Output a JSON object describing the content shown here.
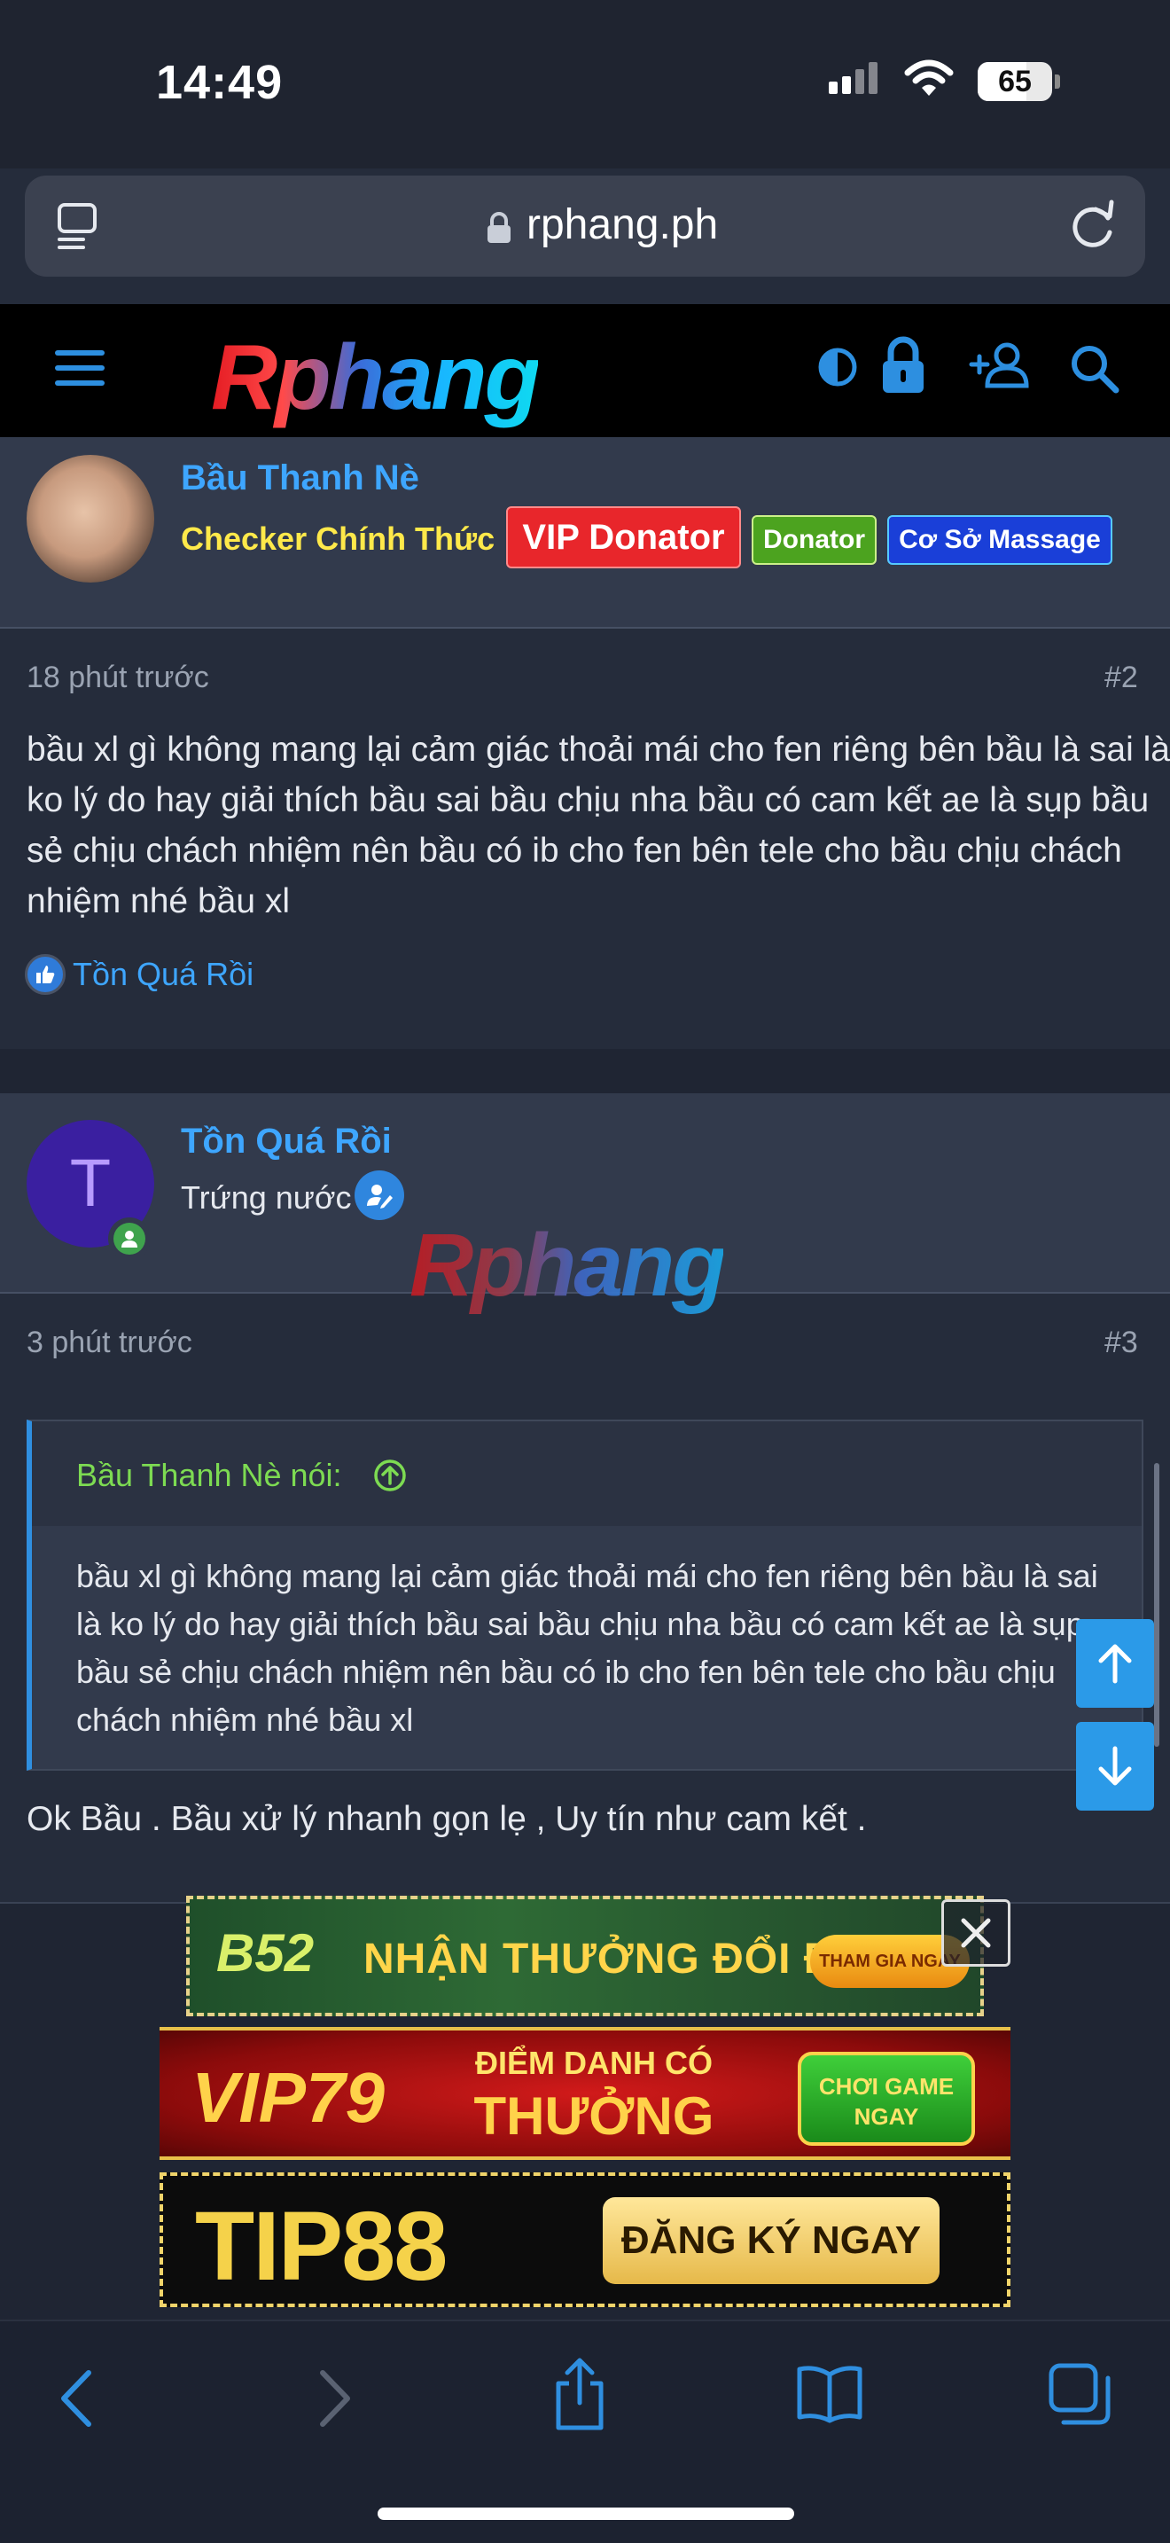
{
  "status": {
    "time": "14:49",
    "battery": "65",
    "battery_level": 0.65
  },
  "browser": {
    "url": "rphang.ph"
  },
  "site": {
    "logo": "Rphang"
  },
  "post1": {
    "username": "Bầu Thanh Nè",
    "user_title": "Checker Chính Thức",
    "badges": [
      "VIP Donator",
      "Donator",
      "Cơ Sở Massage"
    ],
    "time": "18 phút trước",
    "number": "#2",
    "text": "bầu xl gì không mang lại cảm giác thoải mái cho fen riêng bên bầu là sai là ko lý do hay giải thích bầu sai bầu chịu nha bầu có cam kết ae là sụp bầu sẻ chịu chách nhiệm nên bầu có ib cho fen bên tele cho bầu chịu chách nhiệm nhé bầu xl",
    "reaction_user": "Tồn Quá Rồi"
  },
  "post2": {
    "username": "Tồn Quá Rồi",
    "avatar_letter": "T",
    "rank": "Trứng nước",
    "watermark": "Rphang",
    "time": "3 phút trước",
    "number": "#3",
    "quote_author": "Bầu Thanh Nè nói:",
    "quote_text": "bầu xl gì không mang lại cảm giác thoải mái cho fen riêng bên bầu là sai là ko lý do hay giải thích bầu sai bầu chịu nha bầu có cam kết ae là sụp bầu sẻ chịu chách nhiệm nên bầu có ib cho fen bên tele cho bầu chịu chách nhiệm nhé bầu xl",
    "text": "Ok Bầu . Bầu xử lý nhanh gọn lẹ , Uy tín như cam kết ."
  },
  "ads": {
    "ad1": {
      "brand": "B52",
      "slogan": "NHẬN THƯỞNG ĐỔI ĐỜI",
      "cta": "THAM GIA NGAY"
    },
    "ad2": {
      "brand": "VIP79",
      "line1": "ĐIỂM DANH CÓ",
      "line2": "THƯỞNG",
      "cta": "CHƠI GAME NGAY"
    },
    "ad3": {
      "brand": "TIP88",
      "cta": "ĐĂNG KÝ NGAY"
    }
  },
  "colors": {
    "accent": "#3ea6ff",
    "background": "#252c3b",
    "panel": "#323a4c",
    "quote_author": "#7ddb52",
    "user_title": "#ffe94a"
  }
}
